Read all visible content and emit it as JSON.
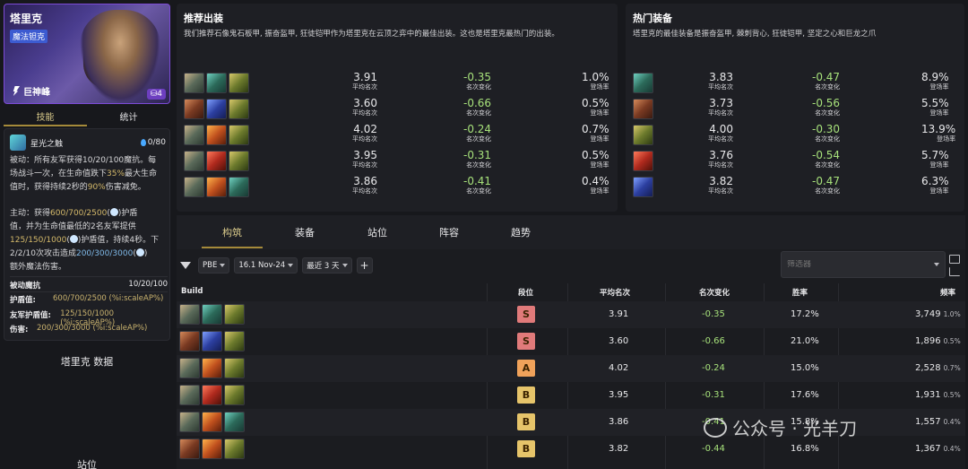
{
  "champion": {
    "name": "塔里克",
    "role": "魔法钽克",
    "trait": "巨神峰",
    "cost": "4",
    "tabs": [
      "技能",
      "统计"
    ],
    "ability_name": "星光之触",
    "mana": "0/80",
    "passive_text": [
      "被动：所有友军获得10/20/100魔抗。每",
      "场战斗一次，在生命值跌下35%最大生命",
      "值时，获得持续2秒的90%伤害减免。"
    ],
    "active_text": [
      "主动：获得600/700/2500(",
      ")护盾",
      "值，并为生命值最低的2名友军提供",
      "125/150/1000(",
      ")护盾值，持续4秒。下",
      "2/2/10次攻击造成200/300/3000(",
      ")",
      "额外魔法伤害。"
    ],
    "stats": [
      {
        "label": "被动魔抗",
        "value": "",
        "right": "10/20/100"
      },
      {
        "label": "护盾值:",
        "value": "600/700/2500 (%i:scaleAP%)",
        "right": ""
      },
      {
        "label": "友军护盾值:",
        "value": "125/150/1000 (%i:scaleAP%)",
        "right": ""
      },
      {
        "label": "伤害:",
        "value": "200/300/3000 (%i:scaleAP%)",
        "right": ""
      }
    ],
    "section_data": "塔里克 数据",
    "section_position": "站位"
  },
  "recommended": {
    "title": "推荐出装",
    "desc": "我们推荐石像鬼石板甲, 振奋盔甲, 狂徒铠甲作为塔里克在云顶之弈中的最佳出装。这也是塔里克最热门的出装。",
    "avg_label": "平均名次",
    "change_label": "名次变化",
    "rate_label": "登场率",
    "rows": [
      {
        "items": [
          "gargoyle-item",
          "bramble-item",
          "warmog-item"
        ],
        "avg": "3.91",
        "change": "-0.35",
        "rate": "1.0%"
      },
      {
        "items": [
          "redemption-item",
          "gauntlet-item",
          "warmog-item"
        ],
        "avg": "3.60",
        "change": "-0.66",
        "rate": "0.5%"
      },
      {
        "items": [
          "gargoyle-item",
          "dragonclaw-item",
          "warmog-item"
        ],
        "avg": "4.02",
        "change": "-0.24",
        "rate": "0.7%"
      },
      {
        "items": [
          "gargoyle-item",
          "sunfire-item",
          "warmog-item"
        ],
        "avg": "3.95",
        "change": "-0.31",
        "rate": "0.5%"
      },
      {
        "items": [
          "gargoyle-item",
          "dragonclaw-item",
          "bramble-item"
        ],
        "avg": "3.86",
        "change": "-0.41",
        "rate": "0.4%"
      }
    ]
  },
  "popular": {
    "title": "热门装备",
    "desc": "塔里克的最佳装备是振奋盔甲, 棘刺背心, 狂徒铠甲, 坚定之心和巨龙之爪",
    "rows": [
      {
        "item": "bramble-item",
        "avg": "3.83",
        "change": "-0.47",
        "rate": "8.9%"
      },
      {
        "item": "redemption-item",
        "avg": "3.73",
        "change": "-0.56",
        "rate": "5.5%"
      },
      {
        "item": "warmog-item",
        "avg": "4.00",
        "change": "-0.30",
        "rate": "13.9%"
      },
      {
        "item": "sunfire-item",
        "avg": "3.76",
        "change": "-0.54",
        "rate": "5.7%"
      },
      {
        "item": "gauntlet-item",
        "avg": "3.82",
        "change": "-0.47",
        "rate": "6.3%"
      }
    ]
  },
  "tabs": [
    "构筑",
    "装备",
    "站位",
    "阵容",
    "趋势"
  ],
  "filters": {
    "set": "PBE",
    "patch": "16.1 Nov-24",
    "range": "最近 3 天",
    "add": "+"
  },
  "search": {
    "placeholder": "筛选器"
  },
  "table": {
    "headers": {
      "build": "Build",
      "tier": "段位",
      "avg": "平均名次",
      "change": "名次变化",
      "win": "胜率",
      "freq": "频率"
    },
    "rows": [
      {
        "items": [
          "gargoyle-item",
          "bramble-item",
          "warmog-item"
        ],
        "tier": "S",
        "avg": "3.91",
        "change": "-0.35",
        "win": "17.2%",
        "freq": "3,749",
        "freq_pct": "1.0%"
      },
      {
        "items": [
          "redemption-item",
          "gauntlet-item",
          "warmog-item"
        ],
        "tier": "S",
        "avg": "3.60",
        "change": "-0.66",
        "win": "21.0%",
        "freq": "1,896",
        "freq_pct": "0.5%"
      },
      {
        "items": [
          "gargoyle-item",
          "dragonclaw-item",
          "warmog-item"
        ],
        "tier": "A",
        "avg": "4.02",
        "change": "-0.24",
        "win": "15.0%",
        "freq": "2,528",
        "freq_pct": "0.7%"
      },
      {
        "items": [
          "gargoyle-item",
          "sunfire-item",
          "warmog-item"
        ],
        "tier": "B",
        "avg": "3.95",
        "change": "-0.31",
        "win": "17.6%",
        "freq": "1,931",
        "freq_pct": "0.5%"
      },
      {
        "items": [
          "gargoyle-item",
          "dragonclaw-item",
          "bramble-item"
        ],
        "tier": "B",
        "avg": "3.86",
        "change": "-0.41",
        "win": "15.8%",
        "freq": "1,557",
        "freq_pct": "0.4%"
      },
      {
        "items": [
          "redemption-item",
          "dragonclaw-item",
          "warmog-item"
        ],
        "tier": "B",
        "avg": "3.82",
        "change": "-0.44",
        "win": "16.8%",
        "freq": "1,367",
        "freq_pct": "0.4%"
      }
    ]
  },
  "watermark": "公众号 · 光羊刀",
  "colors": {
    "accent_gold": "#a58a3a",
    "positive": "#a6e07a",
    "tier_S": "#e07a7a",
    "tier_A": "#f0a25a",
    "tier_B": "#e6c46a"
  }
}
